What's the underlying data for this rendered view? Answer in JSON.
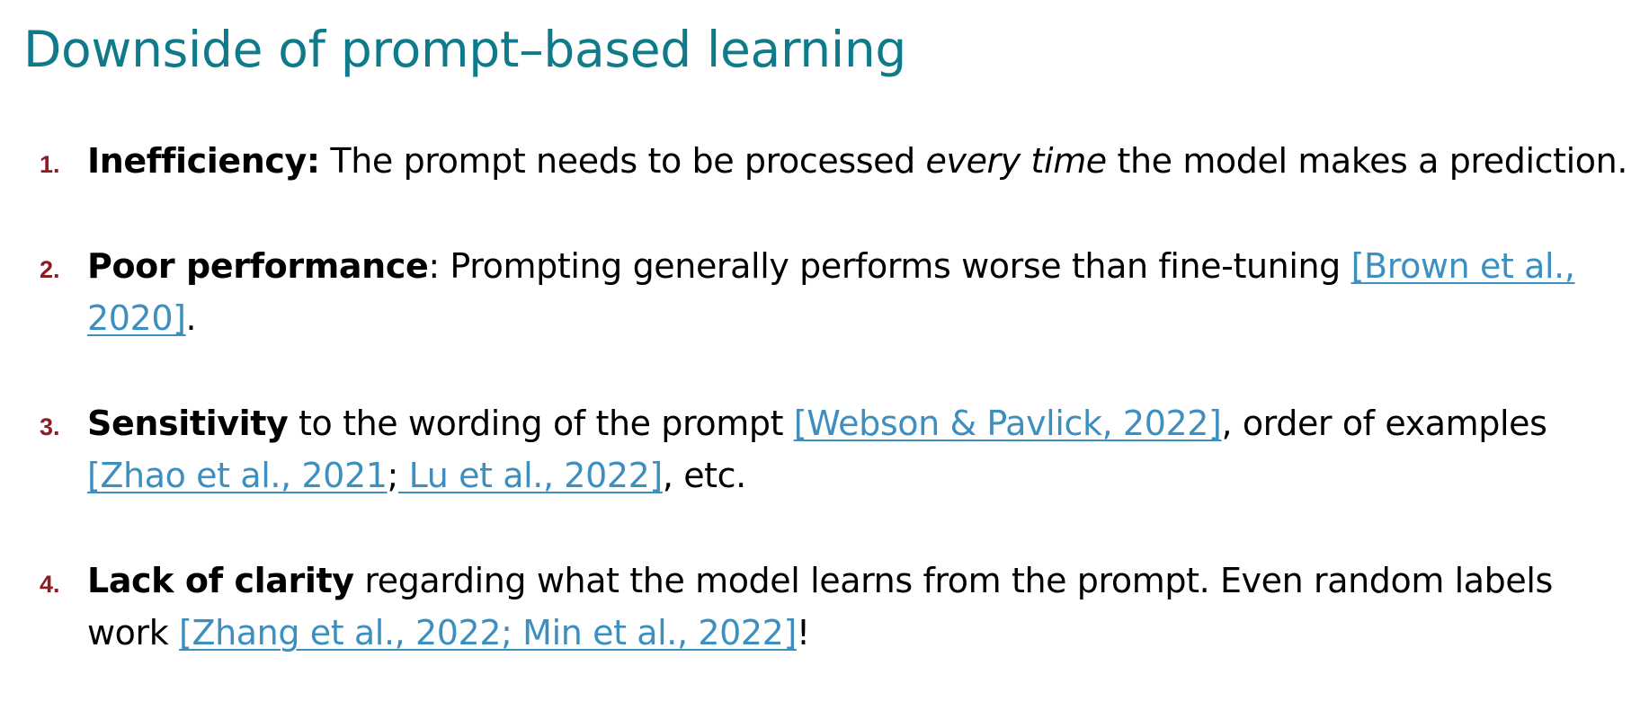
{
  "slide": {
    "title": "Downside of prompt–based learning",
    "colors": {
      "title": "#0f7b8a",
      "number": "#8e1d23",
      "link": "#3d8fc0",
      "text": "#000000"
    }
  },
  "items": [
    {
      "number": "1.",
      "term": "Inefficiency:",
      "text_a": " The prompt needs to be processed ",
      "emphasis": "every time",
      "text_b": " the model makes a prediction."
    },
    {
      "number": "2.",
      "term": "Poor performance",
      "text_a": ": Prompting generally performs worse than fine-tuning ",
      "cite_1": "[Brown et al., 2020]",
      "text_b": "."
    },
    {
      "number": "3.",
      "term": "Sensitivity",
      "text_a": " to the wording of the prompt ",
      "cite_1": "[Webson & Pavlick, 2022]",
      "text_b": ", order of examples ",
      "cite_2": "[Zhao et al., 2021",
      "sep": ";",
      "cite_3": " Lu et al., 2022]",
      "text_c": ", etc."
    },
    {
      "number": "4.",
      "term": "Lack of clarity",
      "text_a": " regarding what the model learns from the prompt. Even random labels work ",
      "cite_1": "[Zhang et al., 2022; Min et al., 2022]",
      "text_b": "!"
    }
  ]
}
